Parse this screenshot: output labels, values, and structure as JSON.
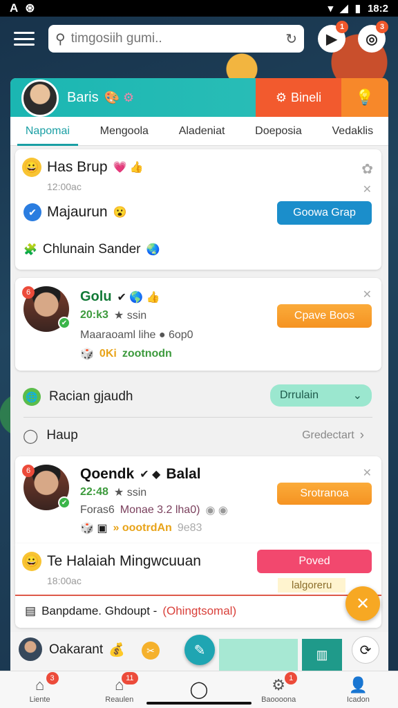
{
  "status_bar": {
    "left_icons": [
      "A",
      "⊛"
    ],
    "time": "18:2"
  },
  "search": {
    "placeholder": "timgosiih gumi.."
  },
  "top_icons": [
    {
      "name": "play-icon",
      "glyph": "▶",
      "badge": "1"
    },
    {
      "name": "target-icon",
      "glyph": "◎",
      "badge": "3"
    }
  ],
  "header": {
    "name": "Baris",
    "badges": "🎨 ⚙",
    "primary_button": "Bineli",
    "primary_icon": "⚙",
    "secondary_icon": "💡"
  },
  "tabs": [
    "Napomai",
    "Mengoola",
    "Aladeniat",
    "Doeposia",
    "Vedaklis"
  ],
  "group_card": {
    "title": "Has Brup",
    "title_emoji": "😀",
    "title_badges": "💗 👍",
    "time": "12:00ac",
    "member_name": "Majaurun",
    "member_emoji": "😮",
    "join_button": "Goowa Grap",
    "footer_text": "Chlunain Sander",
    "footer_emoji": "🌏"
  },
  "user_card_1": {
    "name": "Golu",
    "name_badges": "✔ 🌎 👍",
    "score": "20:k3",
    "score_suffix": "★ ssin",
    "detail": "Maaraoaml lihe ● 6op0",
    "tag": "0Ki",
    "tag_text": "zootnodn",
    "action_button": "Cpave Boos",
    "avatar_badge": "6"
  },
  "line_items": [
    {
      "label": "Racian gjaudh",
      "pill": "Drrulain",
      "icon": "🌐"
    },
    {
      "label": "Haup",
      "link": "Gredectart",
      "icon": "◯"
    }
  ],
  "user_card_2": {
    "name": "Qoendk",
    "name_suffix": "Balal",
    "name_badges": "✔ ◆",
    "score": "22:48",
    "score_suffix": "★ ssin",
    "detail_a": "Foras6",
    "detail_b": "Monae 3.2 lha0)",
    "tag_text": "» oootrdAn",
    "tag_muted": "9e83",
    "action_button": "Srotranoa",
    "avatar_badge": "6"
  },
  "promo_card": {
    "title": "Te Halaiah Mingwcuuan",
    "emoji": "😀",
    "time": "18:00ac",
    "button": "Poved",
    "link": "lalgoreru"
  },
  "notice": {
    "text": "Banpdame. Ghdoupt -",
    "highlight": "(Ohingtsomal)"
  },
  "mini_row": {
    "name": "Oakarant",
    "emoji": "💰"
  },
  "bottom_nav": [
    {
      "label": "Liente",
      "icon": "⌂",
      "badge": "3"
    },
    {
      "label": "Reaulen",
      "icon": "⌂",
      "badge": "11"
    },
    {
      "label": "",
      "icon": "◯",
      "badge": ""
    },
    {
      "label": "Baoooona",
      "icon": "⚙",
      "badge": "1"
    },
    {
      "label": "Icadon",
      "icon": "👤",
      "badge": ""
    }
  ],
  "colors": {
    "teal": "#1bb6b2",
    "orange": "#f7882a",
    "red_orange": "#f25a2e",
    "blue_button": "#1b8ecb",
    "pink_button": "#f2486e"
  }
}
